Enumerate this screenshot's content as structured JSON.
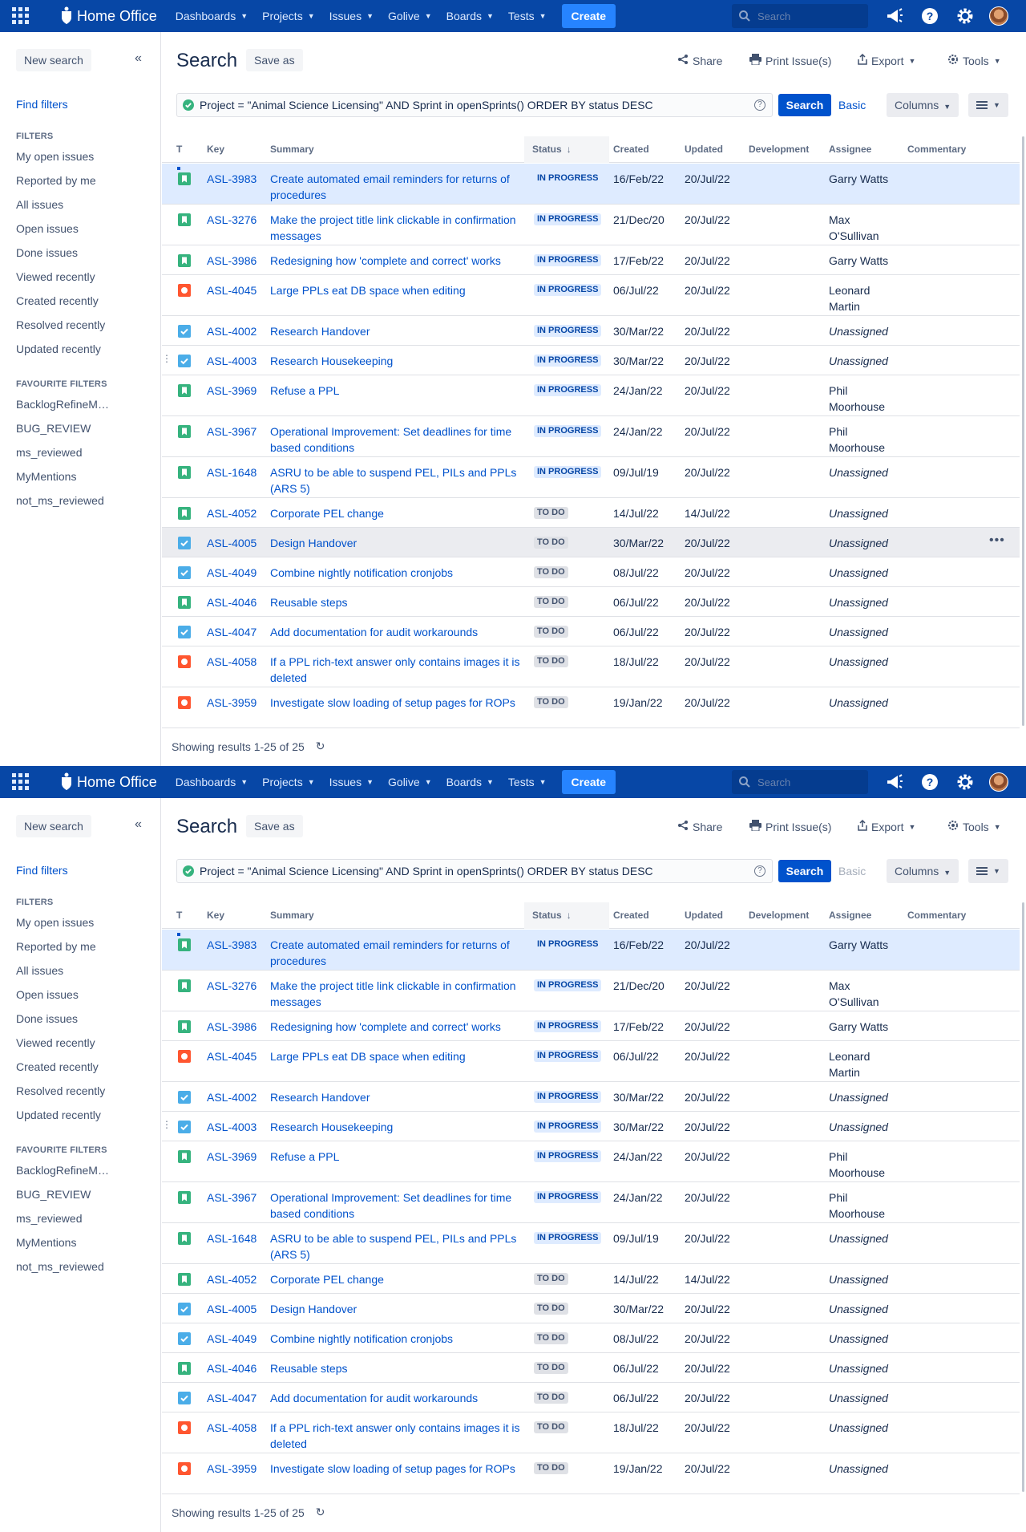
{
  "nav": {
    "brand": "Home Office",
    "items": [
      "Dashboards",
      "Projects",
      "Issues",
      "Golive",
      "Boards",
      "Tests"
    ],
    "create": "Create",
    "search_placeholder": "Search"
  },
  "sidebar": {
    "new_search": "New search",
    "find_filters": "Find filters",
    "filters_title": "FILTERS",
    "filters": [
      "My open issues",
      "Reported by me",
      "All issues",
      "Open issues",
      "Done issues",
      "Viewed recently",
      "Created recently",
      "Resolved recently",
      "Updated recently"
    ],
    "favourites_title": "FAVOURITE FILTERS",
    "favourites": [
      "BacklogRefineM…",
      "BUG_REVIEW",
      "ms_reviewed",
      "MyMentions",
      "not_ms_reviewed"
    ]
  },
  "header": {
    "title": "Search",
    "save_as": "Save as",
    "share": "Share",
    "print": "Print Issue(s)",
    "export": "Export",
    "tools": "Tools"
  },
  "jql": {
    "query": "Project = \"Animal Science Licensing\"  AND Sprint in openSprints() ORDER BY status DESC",
    "search": "Search",
    "basic": "Basic",
    "columns": "Columns"
  },
  "table": {
    "columns": [
      "T",
      "Key",
      "Summary",
      "Status",
      "Created",
      "Updated",
      "Development",
      "Assignee",
      "Commentary"
    ],
    "rows": [
      {
        "type": "story",
        "key": "ASL-3983",
        "summary": "Create automated email reminders for returns of procedures",
        "status": "IN PROGRESS",
        "created": "16/Feb/22",
        "updated": "20/Jul/22",
        "assignee": "Garry Watts"
      },
      {
        "type": "story",
        "key": "ASL-3276",
        "summary": "Make the project title link clickable in confirmation messages",
        "status": "IN PROGRESS",
        "created": "21/Dec/20",
        "updated": "20/Jul/22",
        "assignee": "Max O'Sullivan"
      },
      {
        "type": "story",
        "key": "ASL-3986",
        "summary": "Redesigning how 'complete and correct' works",
        "status": "IN PROGRESS",
        "created": "17/Feb/22",
        "updated": "20/Jul/22",
        "assignee": "Garry Watts"
      },
      {
        "type": "bug",
        "key": "ASL-4045",
        "summary": "Large PPLs eat DB space when editing",
        "status": "IN PROGRESS",
        "created": "06/Jul/22",
        "updated": "20/Jul/22",
        "assignee": "Leonard Martin"
      },
      {
        "type": "task",
        "key": "ASL-4002",
        "summary": "Research Handover",
        "status": "IN PROGRESS",
        "created": "30/Mar/22",
        "updated": "20/Jul/22",
        "assignee": "Unassigned"
      },
      {
        "type": "task",
        "key": "ASL-4003",
        "summary": "Research Housekeeping",
        "status": "IN PROGRESS",
        "created": "30/Mar/22",
        "updated": "20/Jul/22",
        "assignee": "Unassigned"
      },
      {
        "type": "story",
        "key": "ASL-3969",
        "summary": "Refuse a PPL",
        "status": "IN PROGRESS",
        "created": "24/Jan/22",
        "updated": "20/Jul/22",
        "assignee": "Phil Moorhouse"
      },
      {
        "type": "story",
        "key": "ASL-3967",
        "summary": "Operational Improvement: Set deadlines for time based conditions",
        "status": "IN PROGRESS",
        "created": "24/Jan/22",
        "updated": "20/Jul/22",
        "assignee": "Phil Moorhouse"
      },
      {
        "type": "story",
        "key": "ASL-1648",
        "summary": "ASRU to be able to suspend PEL, PILs and PPLs (ARS 5)",
        "status": "IN PROGRESS",
        "created": "09/Jul/19",
        "updated": "20/Jul/22",
        "assignee": "Unassigned"
      },
      {
        "type": "story",
        "key": "ASL-4052",
        "summary": "Corporate PEL change",
        "status": "TO DO",
        "created": "14/Jul/22",
        "updated": "14/Jul/22",
        "assignee": "Unassigned"
      },
      {
        "type": "task",
        "key": "ASL-4005",
        "summary": "Design Handover",
        "status": "TO DO",
        "created": "30/Mar/22",
        "updated": "20/Jul/22",
        "assignee": "Unassigned"
      },
      {
        "type": "task",
        "key": "ASL-4049",
        "summary": "Combine nightly notification cronjobs",
        "status": "TO DO",
        "created": "08/Jul/22",
        "updated": "20/Jul/22",
        "assignee": "Unassigned"
      },
      {
        "type": "story",
        "key": "ASL-4046",
        "summary": "Reusable steps",
        "status": "TO DO",
        "created": "06/Jul/22",
        "updated": "20/Jul/22",
        "assignee": "Unassigned"
      },
      {
        "type": "task",
        "key": "ASL-4047",
        "summary": "Add documentation for audit workarounds",
        "status": "TO DO",
        "created": "06/Jul/22",
        "updated": "20/Jul/22",
        "assignee": "Unassigned"
      },
      {
        "type": "bug",
        "key": "ASL-4058",
        "summary": "If a PPL rich-text answer only contains images it is deleted",
        "status": "TO DO",
        "created": "18/Jul/22",
        "updated": "20/Jul/22",
        "assignee": "Unassigned"
      },
      {
        "type": "bug",
        "key": "ASL-3959",
        "summary": "Investigate slow loading of setup pages for ROPs",
        "status": "TO DO",
        "created": "19/Jan/22",
        "updated": "20/Jul/22",
        "assignee": "Unassigned"
      }
    ]
  },
  "footer": {
    "results": "Showing results 1-25 of 25"
  }
}
